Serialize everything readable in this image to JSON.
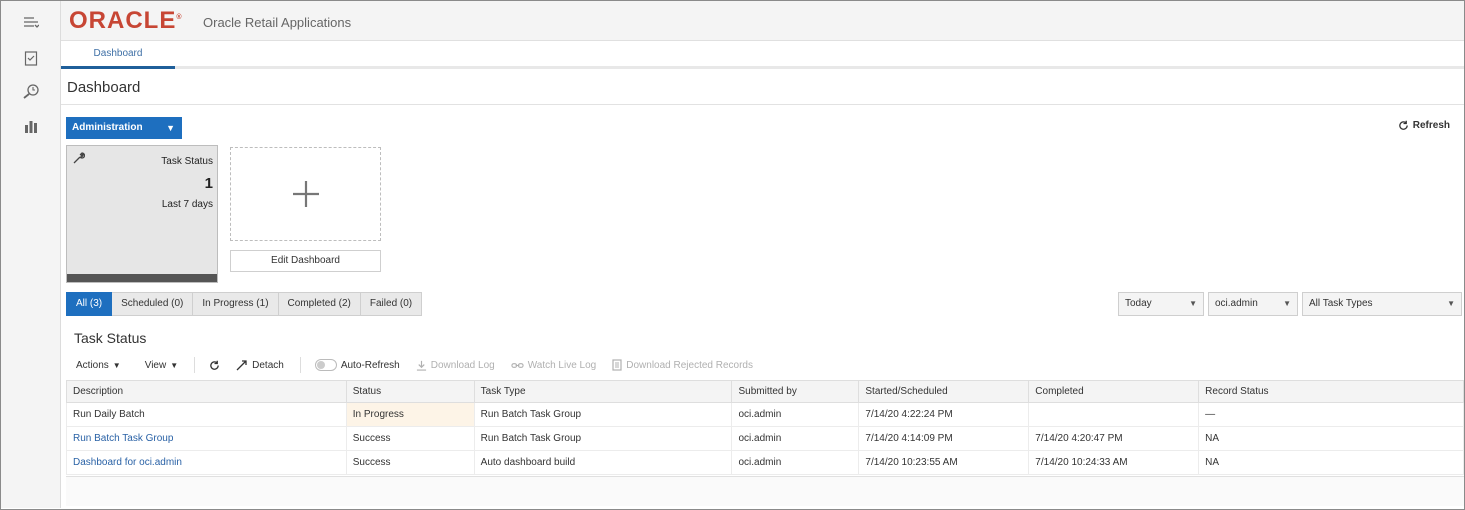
{
  "app": {
    "brand": "ORACLE",
    "brand_mark": "®",
    "title": "Oracle Retail Applications"
  },
  "nav": {
    "tab_dashboard": "Dashboard"
  },
  "page": {
    "title": "Dashboard",
    "admin_menu": "Administration",
    "refresh_label": "Refresh"
  },
  "tile": {
    "title": "Task Status",
    "count": "1",
    "period": "Last 7 days"
  },
  "edit_dashboard": "Edit Dashboard",
  "filters": {
    "tabs": [
      "All (3)",
      "Scheduled (0)",
      "In Progress (1)",
      "Completed (2)",
      "Failed (0)"
    ],
    "date": "Today",
    "user": "oci.admin",
    "task_type": "All Task Types"
  },
  "task_status": {
    "title": "Task Status",
    "toolbar": {
      "actions": "Actions",
      "view": "View",
      "detach": "Detach",
      "auto_refresh": "Auto-Refresh",
      "download_log": "Download Log",
      "watch_live_log": "Watch Live Log",
      "download_rejected": "Download Rejected Records"
    },
    "columns": [
      "Description",
      "Status",
      "Task Type",
      "Submitted by",
      "Started/Scheduled",
      "Completed",
      "Record Status"
    ],
    "rows": [
      [
        "Run Daily Batch",
        "In Progress",
        "Run Batch Task Group",
        "oci.admin",
        "7/14/20 4:22:24 PM",
        "",
        "—"
      ],
      [
        "Run Batch Task Group",
        "Success",
        "Run Batch Task Group",
        "oci.admin",
        "7/14/20 4:14:09 PM",
        "7/14/20 4:20:47 PM",
        "NA"
      ],
      [
        "Dashboard for oci.admin",
        "Success",
        "Auto dashboard build",
        "oci.admin",
        "7/14/20 10:23:55 AM",
        "7/14/20 10:24:33 AM",
        "NA"
      ]
    ]
  },
  "colors": {
    "brand_red": "#c74634",
    "primary_blue": "#1e6fbf",
    "link_blue": "#2a62a6"
  }
}
